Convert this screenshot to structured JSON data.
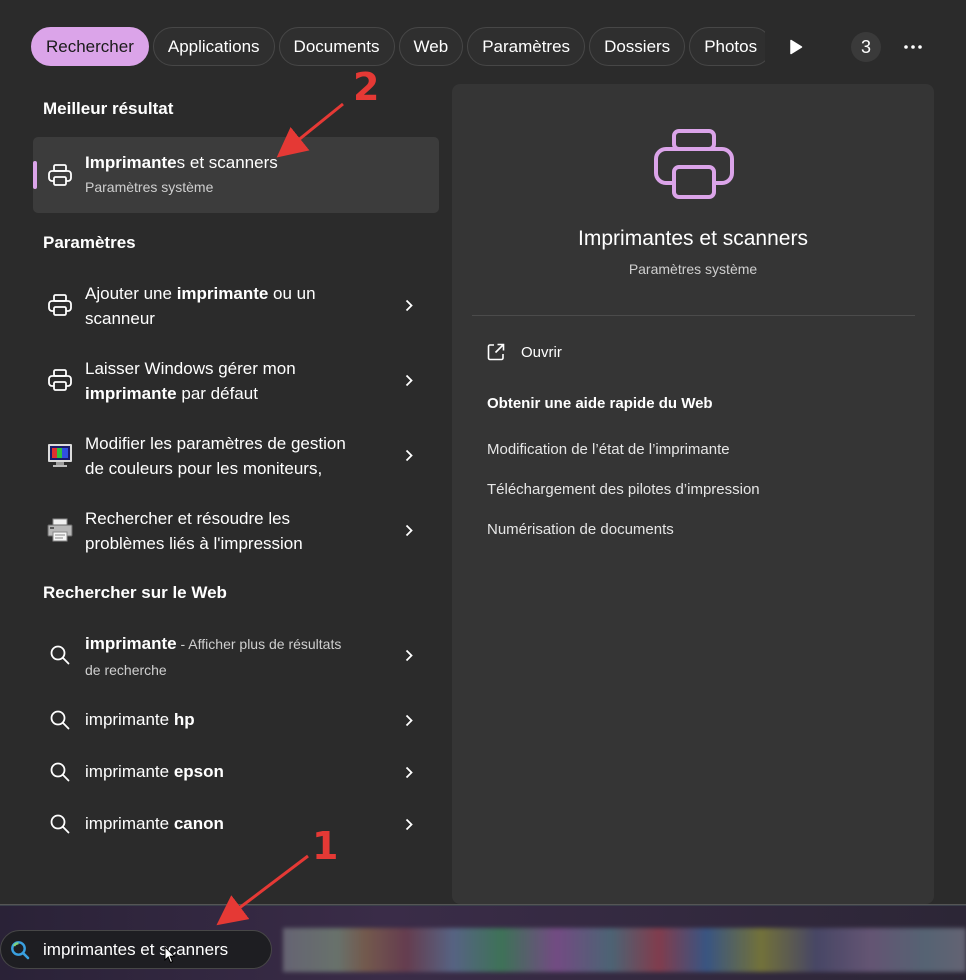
{
  "tabs": [
    {
      "label": "Rechercher",
      "active": true
    },
    {
      "label": "Applications"
    },
    {
      "label": "Documents"
    },
    {
      "label": "Web"
    },
    {
      "label": "Paramètres"
    },
    {
      "label": "Dossiers"
    },
    {
      "label": "Photos"
    }
  ],
  "tab_controls": {
    "count": "3",
    "play_icon": "play-icon",
    "more_icon": "more-icon"
  },
  "best_match": {
    "section_title": "Meilleur résultat",
    "title_bold": "Imprimante",
    "title_rest": "s et scanners",
    "subtitle": "Paramètres système"
  },
  "settings": {
    "section_title": "Paramètres",
    "items": [
      {
        "l1a": "Ajouter une ",
        "l1b": "imprimante",
        "l1c": " ou un",
        "l2a": "scanneur",
        "l2b": "",
        "l2c": ""
      },
      {
        "l1a": "Laisser Windows gérer mon",
        "l1b": "",
        "l1c": "",
        "l2a": "",
        "l2b": "imprimante",
        "l2c": " par défaut"
      },
      {
        "l1a": "Modifier les paramètres de gestion",
        "l1b": "",
        "l1c": "",
        "l2a": "de couleurs pour les moniteurs,",
        "l2b": "",
        "l2c": ""
      },
      {
        "l1a": "Rechercher et résoudre les",
        "l1b": "",
        "l1c": "",
        "l2a": "problèmes liés à l'impression",
        "l2b": "",
        "l2c": ""
      }
    ]
  },
  "web": {
    "section_title": "Rechercher sur le Web",
    "first": {
      "bold": "imprimante",
      "sub_line1": " - Afficher plus de résultats",
      "sub_line2": "de recherche"
    },
    "items": [
      {
        "prefix": "imprimante ",
        "bold": "hp"
      },
      {
        "prefix": "imprimante ",
        "bold": "epson"
      },
      {
        "prefix": "imprimante ",
        "bold": "canon"
      }
    ]
  },
  "preview": {
    "title": "Imprimantes et scanners",
    "subtitle": "Paramètres système",
    "open_label": "Ouvrir",
    "web_help_title": "Obtenir une aide rapide du Web",
    "links": [
      "Modification de l’état de l’imprimante",
      "Téléchargement des pilotes d’impression",
      "Numérisation de documents"
    ]
  },
  "search": {
    "value": "imprimantes et scanners"
  },
  "annotations": [
    "1",
    "2"
  ],
  "colors": {
    "accent": "#dba4e9",
    "arrow": "#e53935"
  }
}
